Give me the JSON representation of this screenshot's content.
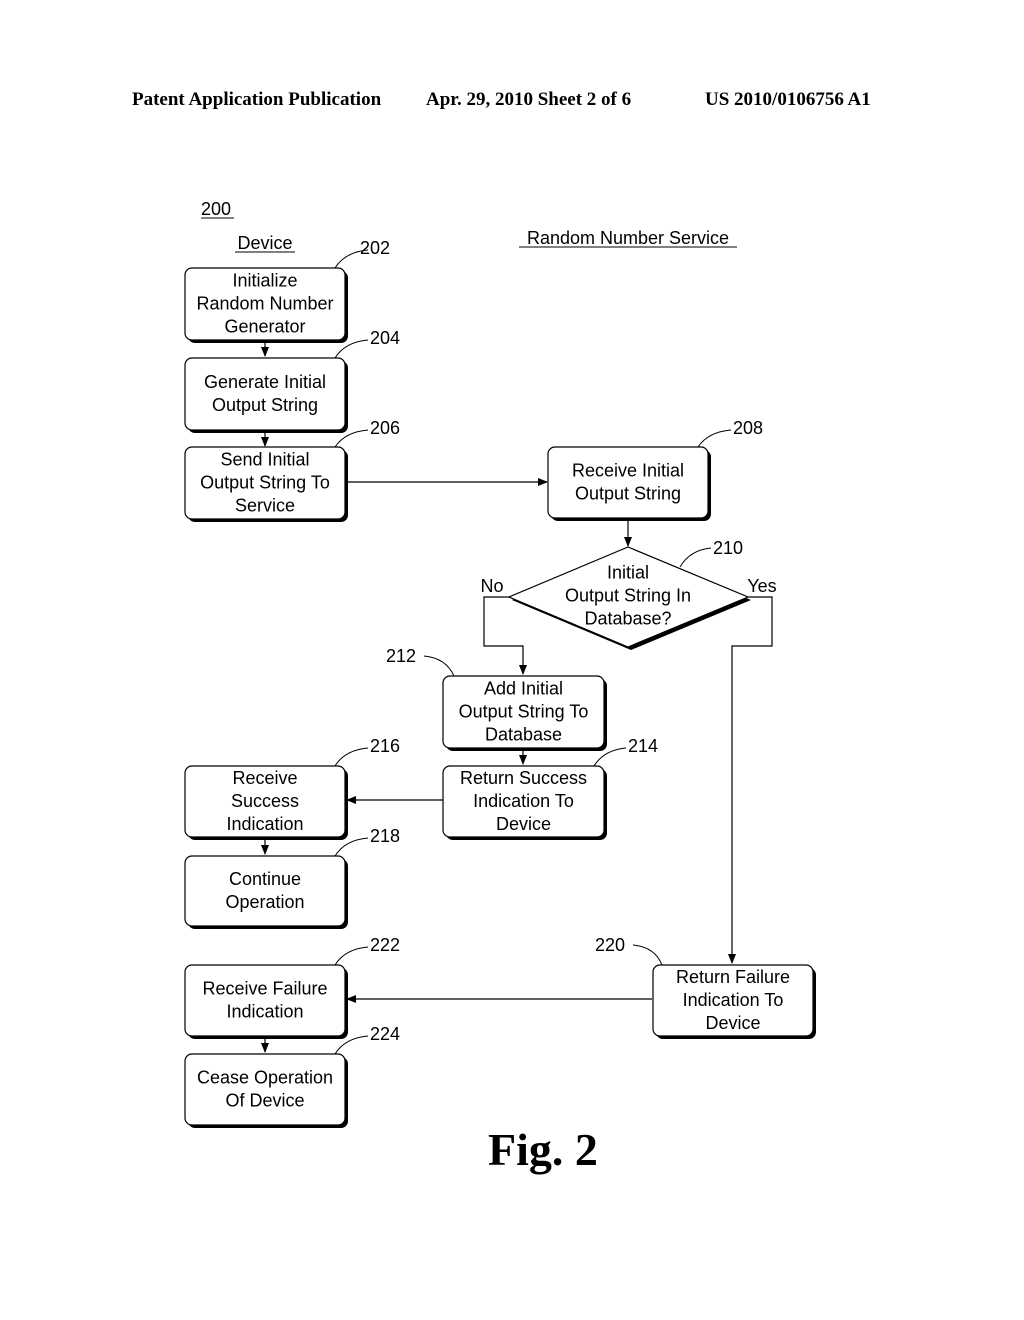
{
  "header": {
    "left": "Patent Application Publication",
    "center": "Apr. 29, 2010  Sheet 2 of 6",
    "right": "US 2010/0106756 A1"
  },
  "diagram": {
    "figure_ref": "200",
    "lanes": {
      "device": "Device",
      "service": "Random Number Service"
    },
    "nodes": [
      {
        "id": "202",
        "lines": [
          "Initialize",
          "Random Number",
          "Generator"
        ]
      },
      {
        "id": "204",
        "lines": [
          "Generate Initial",
          "Output String"
        ]
      },
      {
        "id": "206",
        "lines": [
          "Send Initial",
          "Output String To",
          "Service"
        ]
      },
      {
        "id": "208",
        "lines": [
          "Receive Initial",
          "Output String"
        ]
      },
      {
        "id": "210",
        "lines": [
          "Initial",
          "Output String In",
          "Database?"
        ],
        "shape": "diamond"
      },
      {
        "id": "212",
        "lines": [
          "Add Initial",
          "Output String To",
          "Database"
        ]
      },
      {
        "id": "214",
        "lines": [
          "Return Success",
          "Indication To",
          "Device"
        ]
      },
      {
        "id": "216",
        "lines": [
          "Receive",
          "Success",
          "Indication"
        ]
      },
      {
        "id": "218",
        "lines": [
          "Continue",
          "Operation"
        ]
      },
      {
        "id": "220",
        "lines": [
          "Return Failure",
          "Indication To",
          "Device"
        ]
      },
      {
        "id": "222",
        "lines": [
          "Receive Failure",
          "Indication"
        ]
      },
      {
        "id": "224",
        "lines": [
          "Cease Operation",
          "Of Device"
        ]
      }
    ],
    "branches": {
      "no": "No",
      "yes": "Yes"
    },
    "caption": "Fig. 2"
  }
}
